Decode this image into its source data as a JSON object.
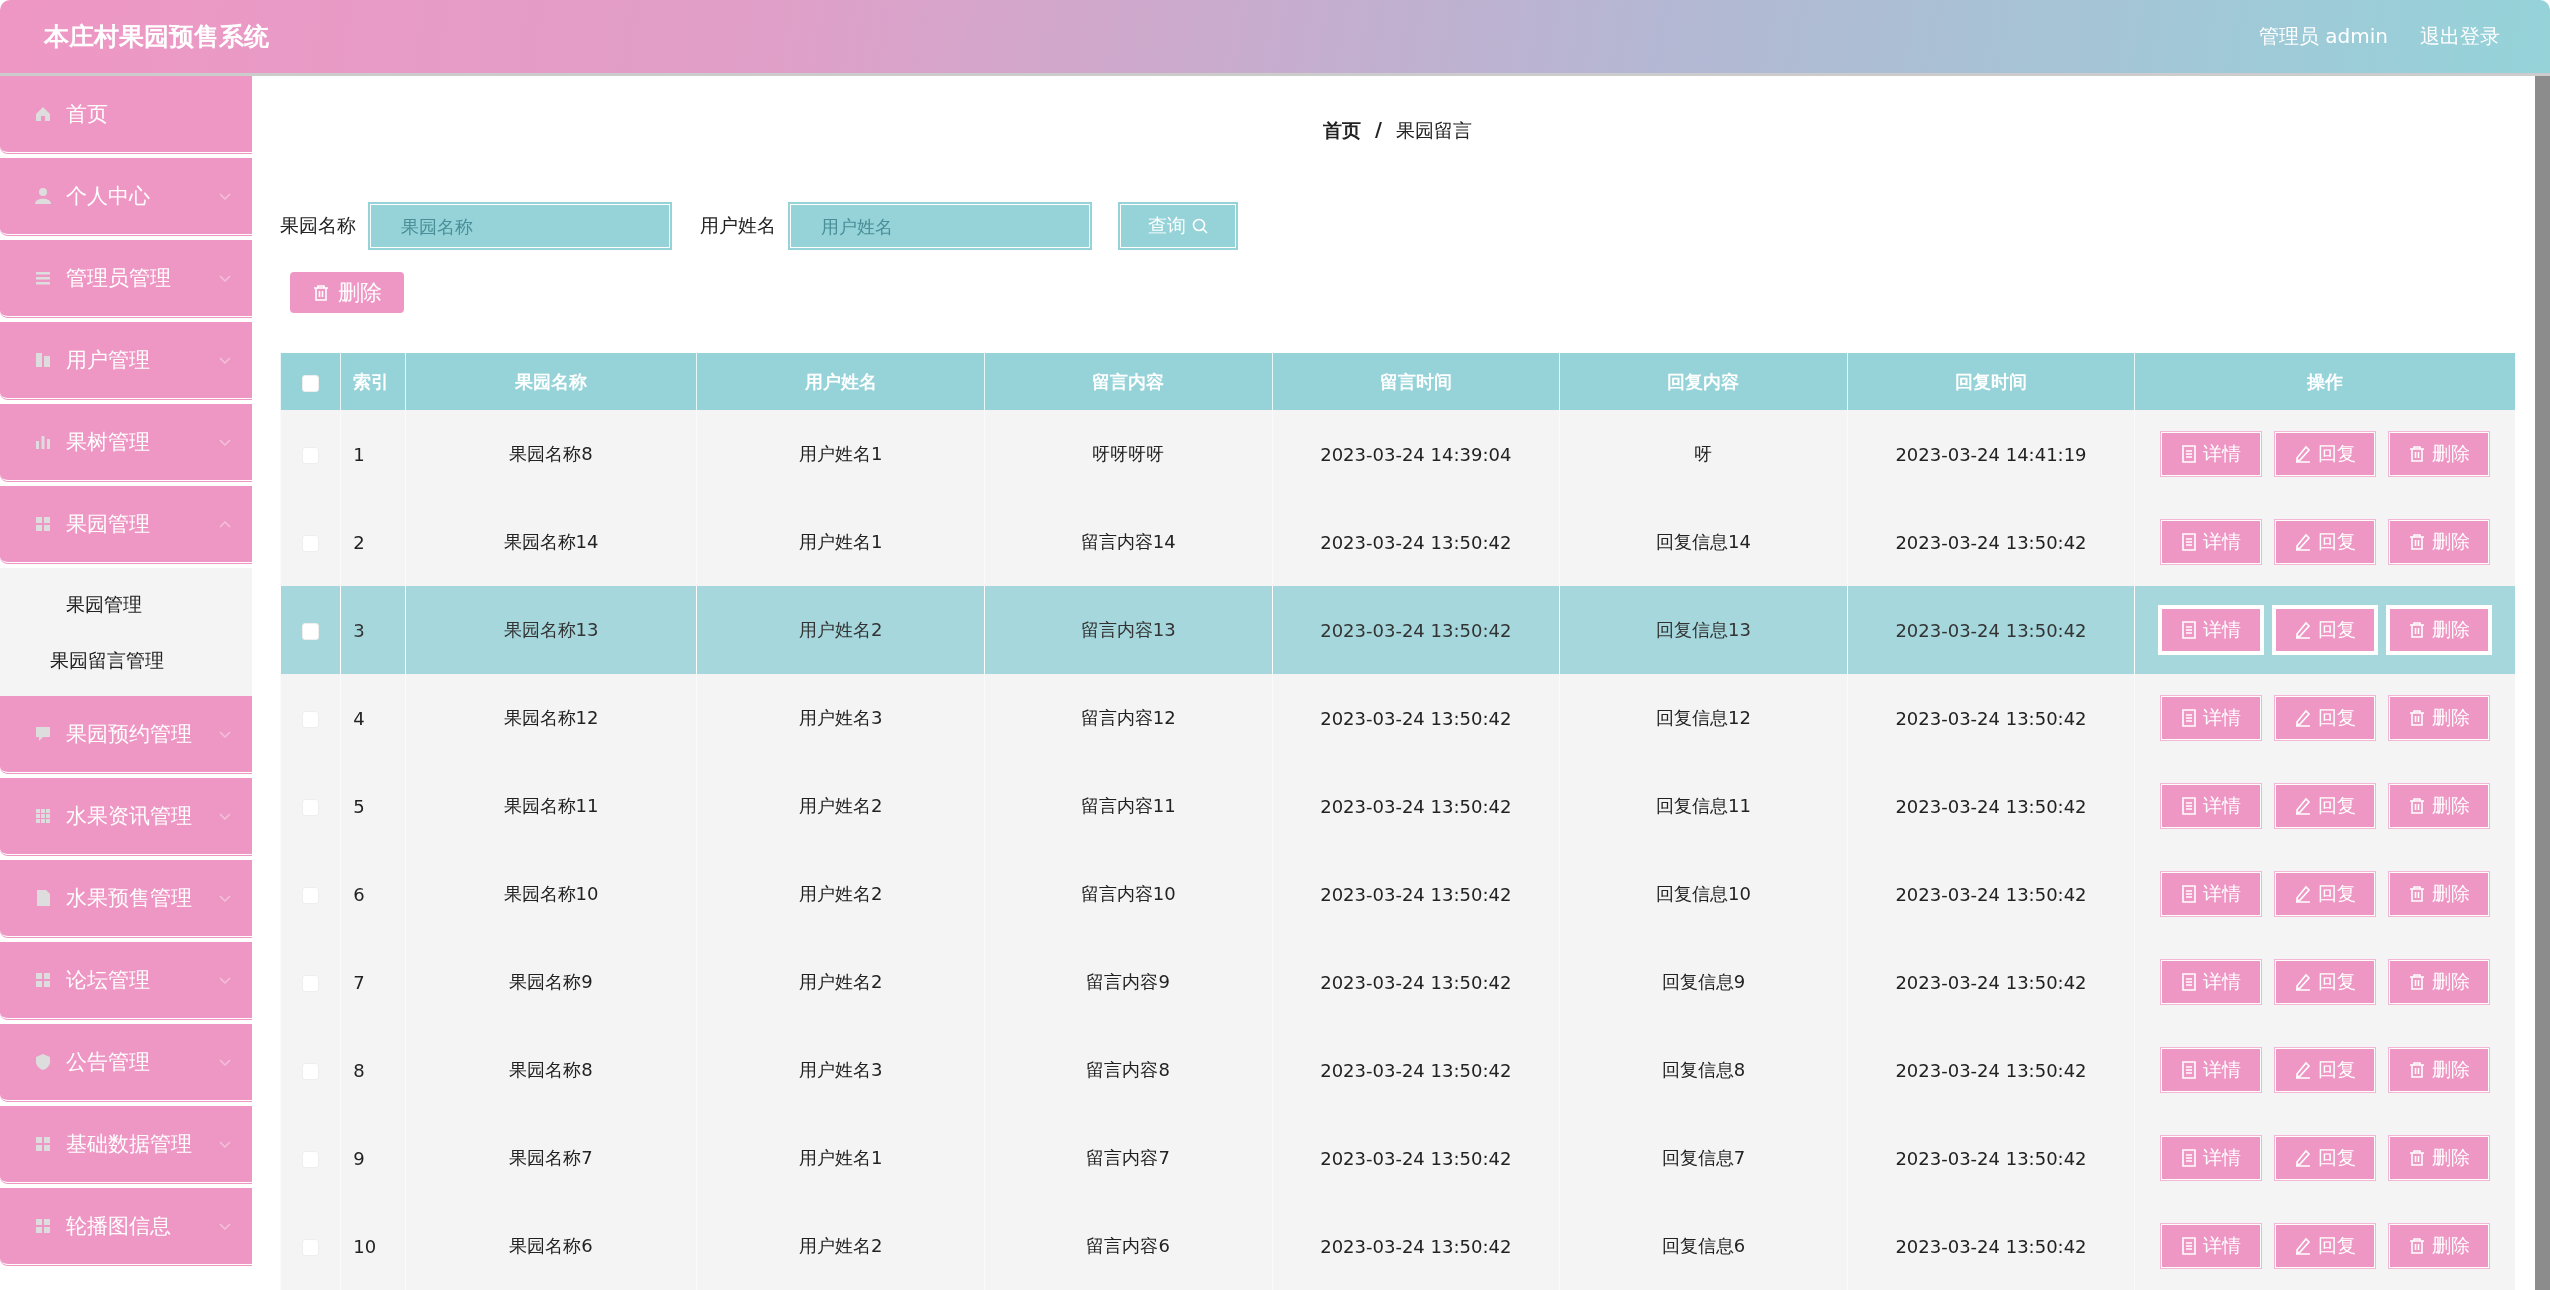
{
  "header": {
    "title": "本庄村果园预售系统",
    "user": "管理员 admin",
    "logout": "退出登录"
  },
  "sidebar": {
    "items": [
      {
        "label": "首页"
      },
      {
        "label": "个人中心",
        "expanded": false
      },
      {
        "label": "管理员管理",
        "expanded": false
      },
      {
        "label": "用户管理",
        "expanded": false
      },
      {
        "label": "果树管理",
        "expanded": false
      },
      {
        "label": "果园管理",
        "expanded": true,
        "children": [
          {
            "label": "果园管理"
          },
          {
            "label": "果园留言管理"
          }
        ]
      },
      {
        "label": "果园预约管理",
        "expanded": false
      },
      {
        "label": "水果资讯管理",
        "expanded": false
      },
      {
        "label": "水果预售管理",
        "expanded": false
      },
      {
        "label": "论坛管理",
        "expanded": false
      },
      {
        "label": "公告管理",
        "expanded": false
      },
      {
        "label": "基础数据管理",
        "expanded": false
      },
      {
        "label": "轮播图信息",
        "expanded": false
      }
    ]
  },
  "breadcrumb": {
    "home": "首页",
    "separator": "/",
    "current": "果园留言"
  },
  "search": {
    "fields": [
      {
        "label": "果园名称",
        "placeholder": "果园名称"
      },
      {
        "label": "用户姓名",
        "placeholder": "用户姓名"
      }
    ],
    "button": "查询"
  },
  "delete_button": "删除",
  "table": {
    "select_all": {
      "checked": false
    },
    "columns": [
      "索引",
      "果园名称",
      "用户姓名",
      "留言内容",
      "留言时间",
      "回复内容",
      "回复时间",
      "操作"
    ],
    "rows": [
      {
        "selected": false,
        "checked": false,
        "cells": [
          "1",
          "果园名称8",
          "用户姓名1",
          "呀呀呀呀",
          "2023-03-24 14:39:04",
          "呀",
          "2023-03-24 14:41:19"
        ],
        "actions": [
          "详情",
          "回复",
          "删除"
        ]
      },
      {
        "selected": false,
        "checked": false,
        "cells": [
          "2",
          "果园名称14",
          "用户姓名1",
          "留言内容14",
          "2023-03-24 13:50:42",
          "回复信息14",
          "2023-03-24 13:50:42"
        ],
        "actions": [
          "详情",
          "回复",
          "删除"
        ]
      },
      {
        "selected": true,
        "checked": false,
        "cells": [
          "3",
          "果园名称13",
          "用户姓名2",
          "留言内容13",
          "2023-03-24 13:50:42",
          "回复信息13",
          "2023-03-24 13:50:42"
        ],
        "actions": [
          "详情",
          "回复",
          "删除"
        ]
      },
      {
        "selected": false,
        "checked": false,
        "cells": [
          "4",
          "果园名称12",
          "用户姓名3",
          "留言内容12",
          "2023-03-24 13:50:42",
          "回复信息12",
          "2023-03-24 13:50:42"
        ],
        "actions": [
          "详情",
          "回复",
          "删除"
        ]
      },
      {
        "selected": false,
        "checked": false,
        "cells": [
          "5",
          "果园名称11",
          "用户姓名2",
          "留言内容11",
          "2023-03-24 13:50:42",
          "回复信息11",
          "2023-03-24 13:50:42"
        ],
        "actions": [
          "详情",
          "回复",
          "删除"
        ]
      },
      {
        "selected": false,
        "checked": false,
        "cells": [
          "6",
          "果园名称10",
          "用户姓名2",
          "留言内容10",
          "2023-03-24 13:50:42",
          "回复信息10",
          "2023-03-24 13:50:42"
        ],
        "actions": [
          "详情",
          "回复",
          "删除"
        ]
      },
      {
        "selected": false,
        "checked": false,
        "cells": [
          "7",
          "果园名称9",
          "用户姓名2",
          "留言内容9",
          "2023-03-24 13:50:42",
          "回复信息9",
          "2023-03-24 13:50:42"
        ],
        "actions": [
          "详情",
          "回复",
          "删除"
        ]
      },
      {
        "selected": false,
        "checked": false,
        "cells": [
          "8",
          "果园名称8",
          "用户姓名3",
          "留言内容8",
          "2023-03-24 13:50:42",
          "回复信息8",
          "2023-03-24 13:50:42"
        ],
        "actions": [
          "详情",
          "回复",
          "删除"
        ]
      },
      {
        "selected": false,
        "checked": false,
        "cells": [
          "9",
          "果园名称7",
          "用户姓名1",
          "留言内容7",
          "2023-03-24 13:50:42",
          "回复信息7",
          "2023-03-24 13:50:42"
        ],
        "actions": [
          "详情",
          "回复",
          "删除"
        ]
      },
      {
        "selected": false,
        "checked": false,
        "cells": [
          "10",
          "果园名称6",
          "用户姓名2",
          "留言内容6",
          "2023-03-24 13:50:42",
          "回复信息6",
          "2023-03-24 13:50:42"
        ],
        "actions": [
          "详情",
          "回复",
          "删除"
        ]
      }
    ]
  }
}
